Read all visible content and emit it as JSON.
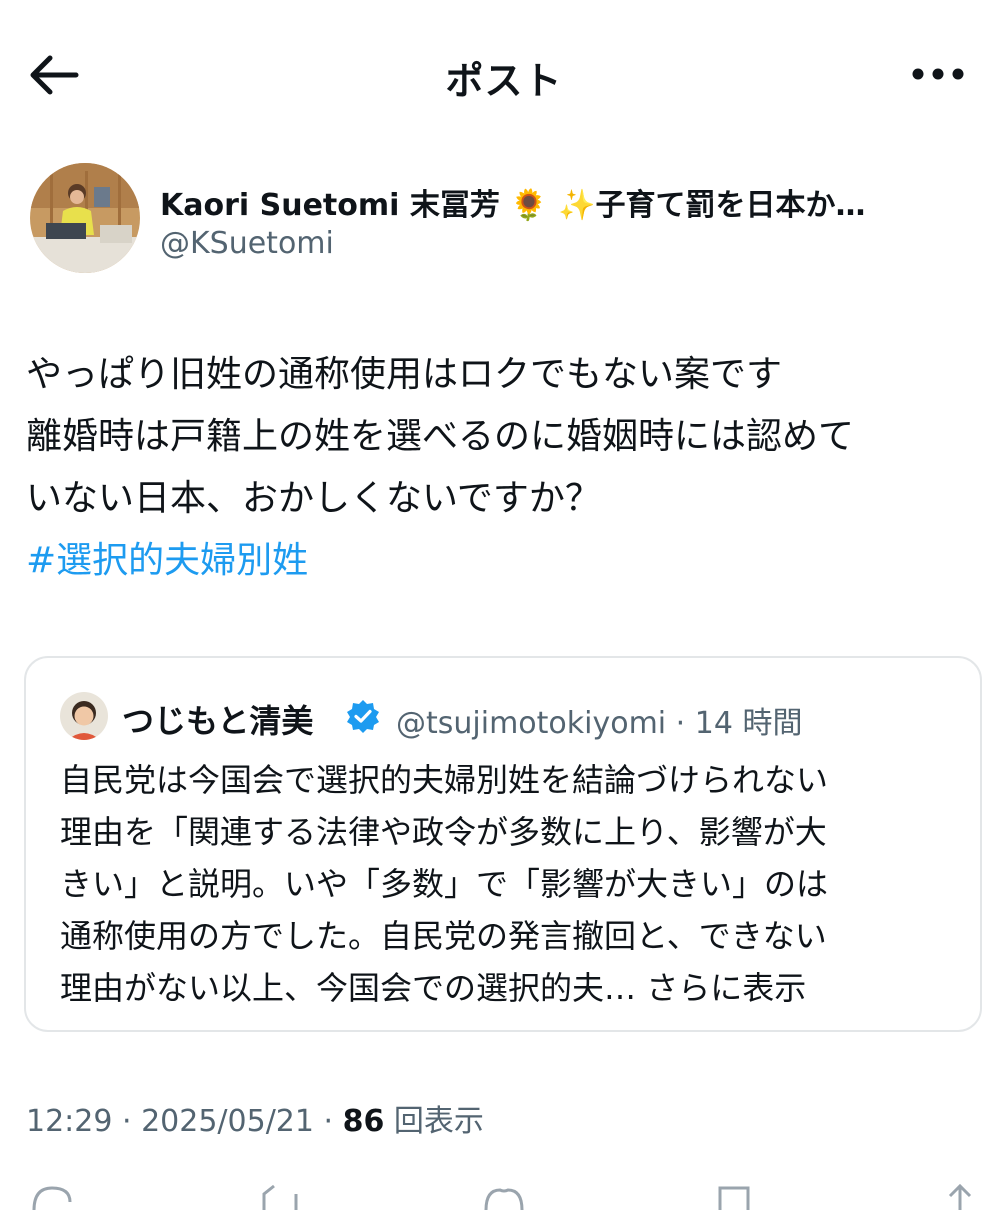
{
  "header": {
    "title": "ポスト",
    "back_icon": "arrow-left-icon",
    "more_icon": "more-horizontal-icon"
  },
  "author": {
    "display_name": "Kaori Suetomi 末冨芳 🌻 ✨子育て罰を日本か…",
    "handle": "@KSuetomi"
  },
  "post": {
    "lines": [
      "やっぱり旧姓の通称使用はロクでもない案です",
      "離婚時は戸籍上の姓を選べるのに婚姻時には認めて",
      "いない日本、おかしくないですか？"
    ],
    "hashtag": "#選択的夫婦別姓"
  },
  "quote": {
    "name": "つじもと清美",
    "handle_time": "@tsujimotokiyomi · 14 時間",
    "lines": [
      "自民党は今国会で選択的夫婦別姓を結論づけられない",
      "理由を「関連する法律や政令が多数に上り、影響が大",
      "きい」と説明。いや「多数」で「影響が大きい」のは",
      "通称使用の方でした。自民党の発言撤回と、できない"
    ],
    "last_line": "理由がない以上、今国会での選択的夫… ",
    "show_more": "さらに表示"
  },
  "meta": {
    "time_date": "12:29 · 2025/05/21 · ",
    "views": "86",
    "views_label": " 回表示"
  },
  "colors": {
    "accent": "#1d9bf0",
    "secondary_text": "#536471",
    "border": "#e3e6e8",
    "verified": "#1d9bf0"
  }
}
